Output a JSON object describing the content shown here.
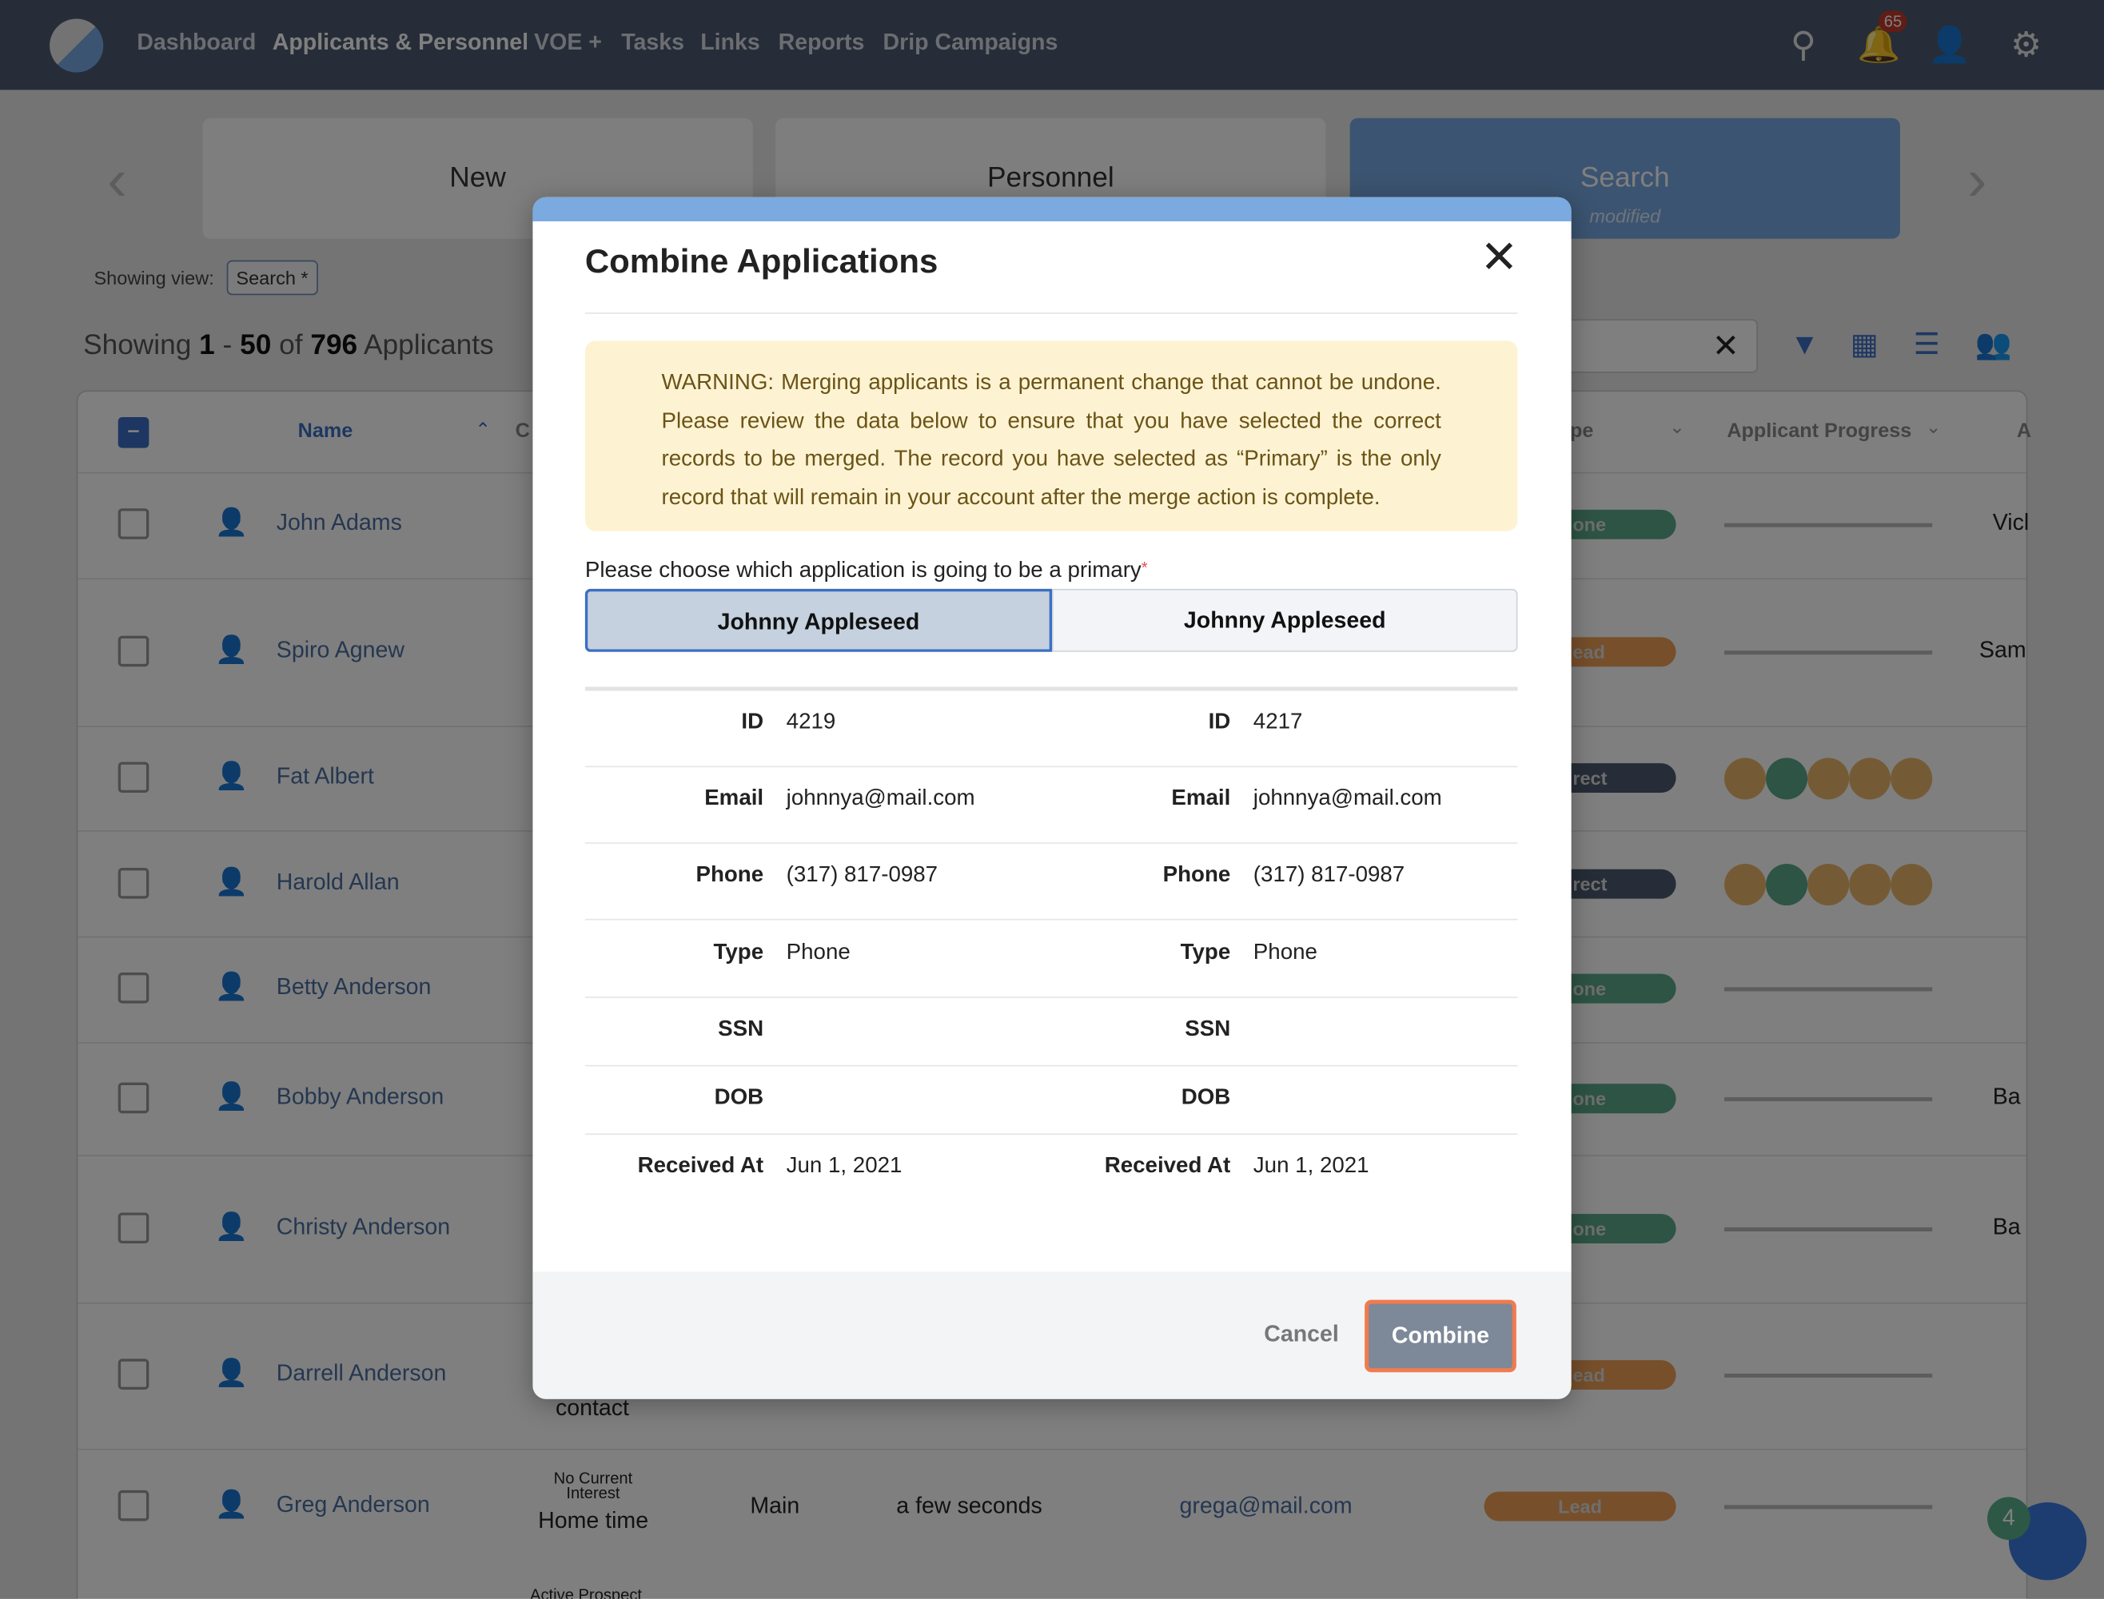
{
  "nav": {
    "links": [
      "Dashboard",
      "Applicants & Personnel",
      "VOE +",
      "Tasks",
      "Links",
      "Reports",
      "Drip Campaigns"
    ],
    "notification_count": "65",
    "icons": [
      "search-icon",
      "bell-icon",
      "add-user-icon",
      "gear-icon"
    ]
  },
  "cards": [
    {
      "label": "New"
    },
    {
      "label": "Personnel"
    },
    {
      "label": "Search",
      "sub": "modified"
    }
  ],
  "view": {
    "label": "Showing view:",
    "value": "Search *"
  },
  "count": {
    "prefix": "Showing",
    "from": "1",
    "sep": "-",
    "to": "50",
    "of": "of",
    "total": "796",
    "suffix": "Applicants"
  },
  "table": {
    "headers": {
      "name": "Name",
      "c": "C",
      "type": "pe",
      "progress": "Applicant Progress",
      "a": "A"
    },
    "rows": [
      {
        "name": "John Adams",
        "pill": "one",
        "pill_color": "#5aa98a",
        "progress": "line",
        "right": "Vicl"
      },
      {
        "name": "Spiro Agnew",
        "pill": "ead",
        "pill_color": "#ef9e56",
        "progress": "line",
        "right": "Sam"
      },
      {
        "name": "Fat Albert",
        "pill": "rect",
        "pill_color": "#4c5a70",
        "progress": "dots",
        "right": ""
      },
      {
        "name": "Harold Allan",
        "pill": "rect",
        "pill_color": "#4c5a70",
        "progress": "dots",
        "right": ""
      },
      {
        "name": "Betty Anderson",
        "pill": "one",
        "pill_color": "#5aa98a",
        "progress": "line",
        "right": ""
      },
      {
        "name": "Bobby Anderson",
        "pill": "one",
        "pill_color": "#5aa98a",
        "progress": "line",
        "right": "Ba"
      },
      {
        "name": "Christy Anderson",
        "pill": "one",
        "pill_color": "#5aa98a",
        "progress": "line",
        "right": "Ba"
      },
      {
        "name": "Darrell Anderson",
        "pill": "ead",
        "pill_color": "#ef9e56",
        "progress": "line",
        "right": "",
        "extra": "contact"
      },
      {
        "name": "Greg Anderson",
        "pill": "Lead",
        "pill_color": "#ef9e56",
        "progress": "line",
        "right": "",
        "status_small": "No Current Interest",
        "status": "Home time",
        "location": "Main",
        "time": "a few seconds",
        "email": "grega@mail.com"
      }
    ],
    "partial_next": "Active Prospect",
    "progress_dot_colors": [
      "#ebb76b",
      "#5aa98a",
      "#ebb76b",
      "#ebb76b",
      "#ebb76b"
    ]
  },
  "modal": {
    "title": "Combine Applications",
    "warning": "WARNING: Merging applicants is a permanent change that cannot be undone. Please review the data below to ensure that you have selected the correct records to be merged. The record you have selected as “Primary” is the only record that will remain in your account after the merge action is complete.",
    "choose_label": "Please choose which application is going to be a primary",
    "required_mark": "*",
    "options": [
      "Johnny Appleseed",
      "Johnny Appleseed"
    ],
    "selected_index": 0,
    "fields": [
      {
        "label": "ID",
        "left": "4219",
        "right": "4217"
      },
      {
        "label": "Email",
        "left": "johnnya@mail.com",
        "right": "johnnya@mail.com"
      },
      {
        "label": "Phone",
        "left": "(317) 817-0987",
        "right": "(317) 817-0987"
      },
      {
        "label": "Type",
        "left": "Phone",
        "right": "Phone"
      },
      {
        "label": "SSN",
        "left": "",
        "right": ""
      },
      {
        "label": "DOB",
        "left": "",
        "right": ""
      },
      {
        "label": "Received At",
        "left": "Jun 1, 2021",
        "right": "Jun 1, 2021"
      }
    ],
    "cancel": "Cancel",
    "combine": "Combine"
  },
  "chat": {
    "badge": "4"
  },
  "colors": {
    "accent": "#7aaadf",
    "nav": "#4c5a70",
    "warning_bg": "#fdf3d3",
    "combine_border": "#ef7b4f"
  }
}
